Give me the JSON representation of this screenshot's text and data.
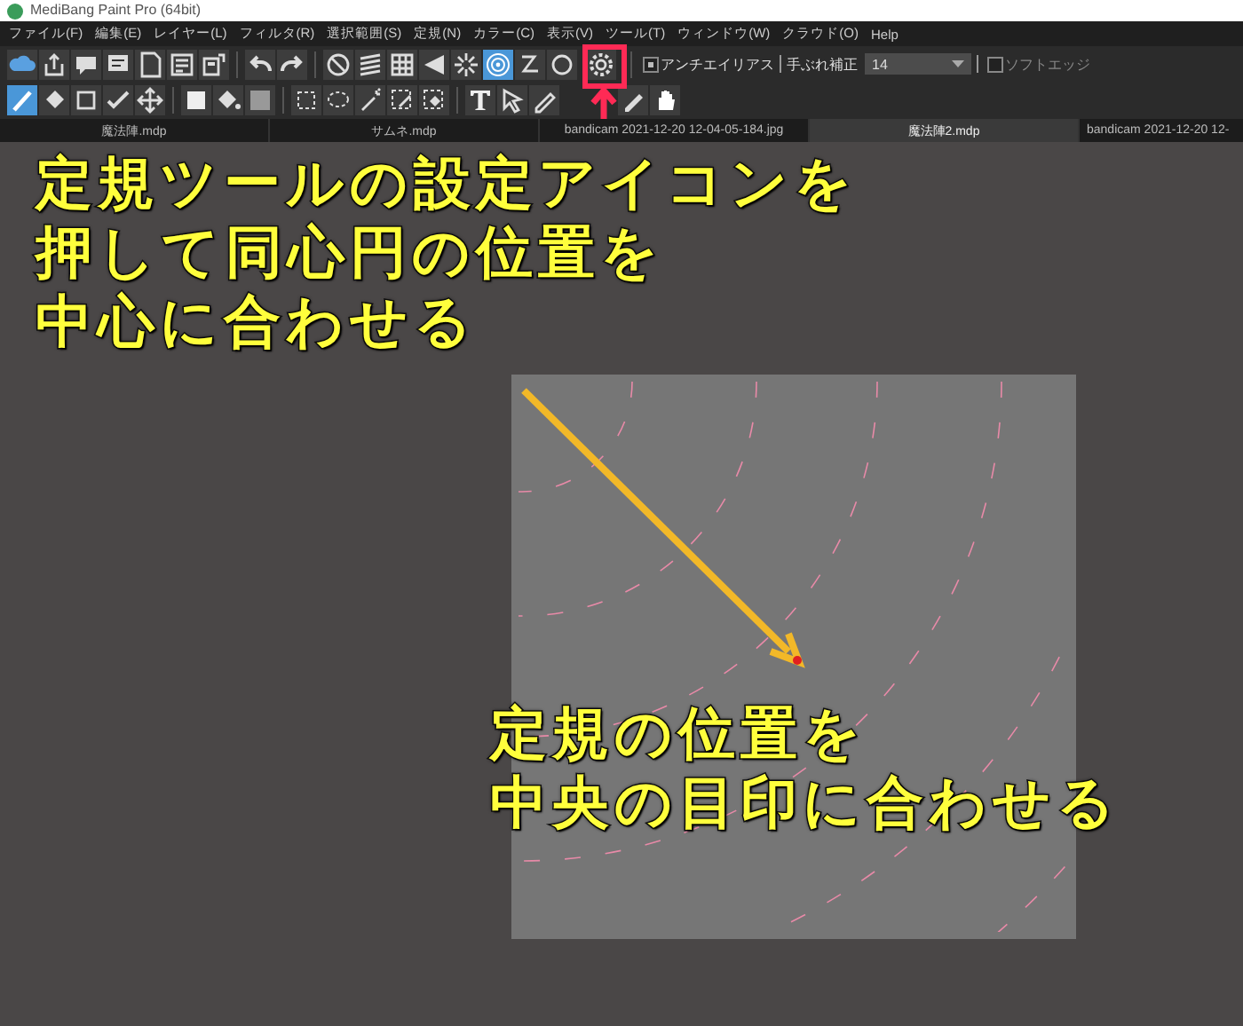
{
  "window": {
    "title": "MediBang Paint Pro (64bit)"
  },
  "menu": [
    "ファイル(F)",
    "編集(E)",
    "レイヤー(L)",
    "フィルタ(R)",
    "選択範囲(S)",
    "定規(N)",
    "カラー(C)",
    "表示(V)",
    "ツール(T)",
    "ウィンドウ(W)",
    "クラウド(O)",
    "Help"
  ],
  "toolbar_1": {
    "buttons": [
      {
        "selected": false
      },
      {
        "selected": false
      },
      {
        "selected": false
      },
      {
        "selected": false
      },
      {
        "selected": false
      },
      {
        "selected": false
      },
      {
        "selected": false
      },
      {
        "selected": false
      },
      {
        "selected": false
      },
      {
        "selected": false
      },
      {
        "selected": false
      },
      {
        "selected": false
      },
      {
        "selected": false
      },
      {
        "selected": false
      },
      {
        "selected": true
      },
      {
        "selected": false
      },
      {
        "selected": false
      },
      {
        "selected": false
      }
    ],
    "antialias": {
      "label": "アンチエイリアス",
      "checked": true
    },
    "stabilizer": {
      "label": "手ぶれ補正",
      "value": "14"
    },
    "soft_edge": {
      "label": "ソフトエッジ",
      "checked": false
    }
  },
  "toolbar_2": {
    "buttons": [
      {
        "selected": true
      },
      {
        "selected": false
      },
      {
        "selected": false
      },
      {
        "selected": false
      },
      {
        "selected": false
      },
      {
        "selected": false
      },
      {
        "selected": false
      },
      {
        "selected": false
      },
      {
        "selected": false
      },
      {
        "selected": false
      },
      {
        "selected": false
      },
      {
        "selected": false
      },
      {
        "selected": false
      },
      {
        "selected": false
      },
      {
        "selected": false
      },
      {
        "selected": false
      },
      {
        "selected": false
      },
      {
        "selected": false
      }
    ]
  },
  "tabs": [
    {
      "label": "魔法陣.mdp",
      "selected": false
    },
    {
      "label": "サムネ.mdp",
      "selected": false
    },
    {
      "label": "bandicam 2021-12-20 12-04-05-184.jpg",
      "selected": false
    },
    {
      "label": "魔法陣2.mdp",
      "selected": true
    },
    {
      "label": "bandicam 2021-12-20 12-",
      "selected": false
    }
  ],
  "annotations": [
    {
      "lines": [
        "定規ツールの設定アイコンを",
        "押して同心円の位置を",
        "中心に合わせる"
      ]
    },
    {
      "lines": [
        "定規の位置を",
        "中央の目印に合わせる"
      ]
    }
  ]
}
